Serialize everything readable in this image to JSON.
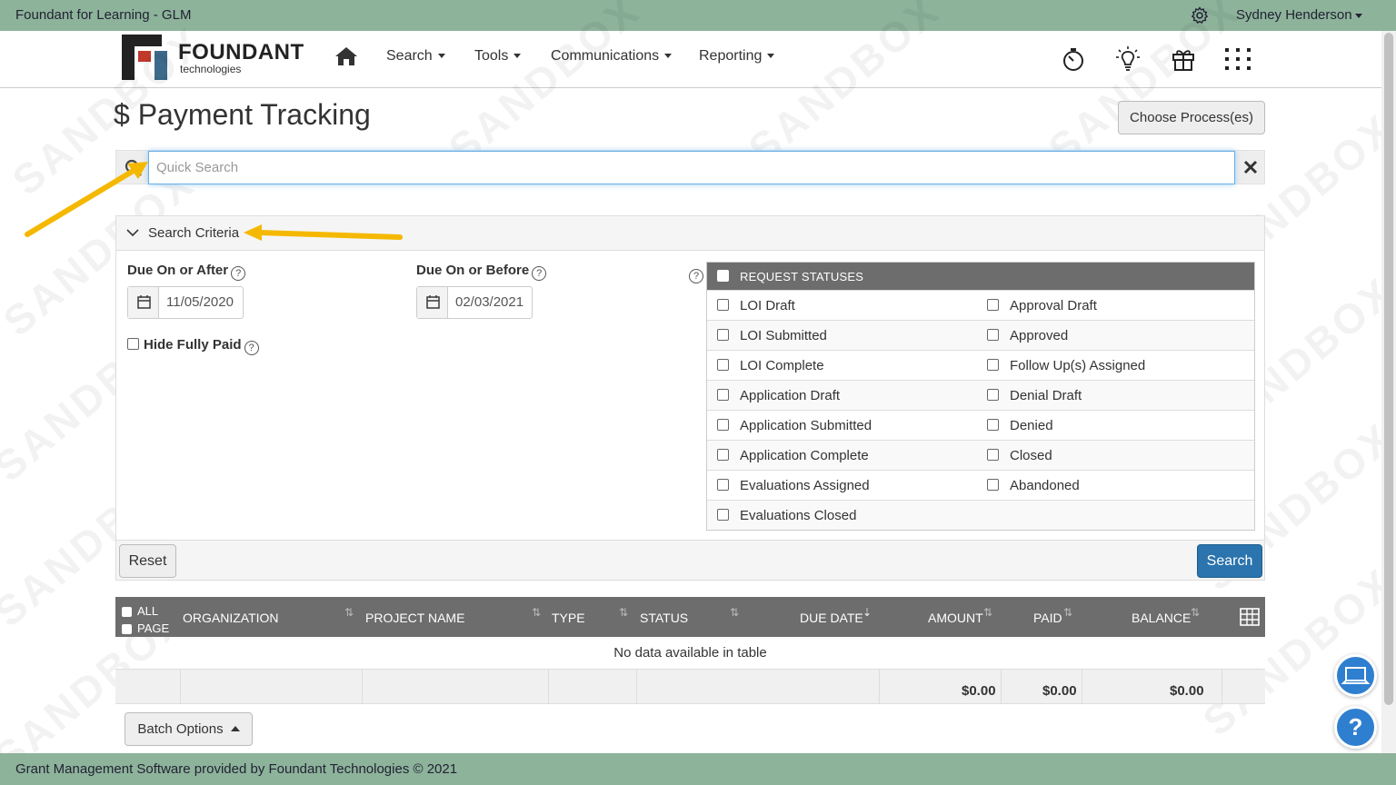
{
  "topbar": {
    "app_title": "Foundant for Learning - GLM",
    "user_name": "Sydney Henderson"
  },
  "logo": {
    "word": "FOUNDANT",
    "sub": "technologies"
  },
  "nav": {
    "menus": [
      "Search",
      "Tools",
      "Communications",
      "Reporting"
    ]
  },
  "watermark": "SANDBOX",
  "page": {
    "title_icon": "$",
    "title": "Payment Tracking",
    "choose_button": "Choose Process(es)"
  },
  "quick_search": {
    "placeholder": "Quick Search",
    "value": ""
  },
  "criteria": {
    "header": "Search Criteria",
    "due_after_label": "Due On or After",
    "due_after_value": "11/05/2020",
    "due_before_label": "Due On or Before",
    "due_before_value": "02/03/2021",
    "hide_paid_label": "Hide Fully Paid",
    "statuses_header": "REQUEST STATUSES",
    "statuses_left": [
      "LOI Draft",
      "LOI Submitted",
      "LOI Complete",
      "Application Draft",
      "Application Submitted",
      "Application Complete",
      "Evaluations Assigned",
      "Evaluations Closed"
    ],
    "statuses_right": [
      "Approval Draft",
      "Approved",
      "Follow Up(s) Assigned",
      "Denial Draft",
      "Denied",
      "Closed",
      "Abandoned"
    ],
    "reset_button": "Reset",
    "search_button": "Search"
  },
  "table": {
    "select_all": "ALL",
    "select_page": "PAGE",
    "columns": [
      "ORGANIZATION",
      "PROJECT NAME",
      "TYPE",
      "STATUS",
      "DUE DATE",
      "AMOUNT",
      "PAID",
      "BALANCE"
    ],
    "empty_message": "No data available in table",
    "totals": {
      "amount": "$0.00",
      "paid": "$0.00",
      "balance": "$0.00"
    },
    "batch_button": "Batch Options"
  },
  "footer": {
    "text": "Grant Management Software provided by Foundant Technologies © 2021"
  },
  "help_label": "?",
  "colors": {
    "topbar": "#8db39b",
    "primary_button": "#2b74ad",
    "table_header": "#6d6d6d",
    "annotation_arrow": "#f5b800"
  }
}
